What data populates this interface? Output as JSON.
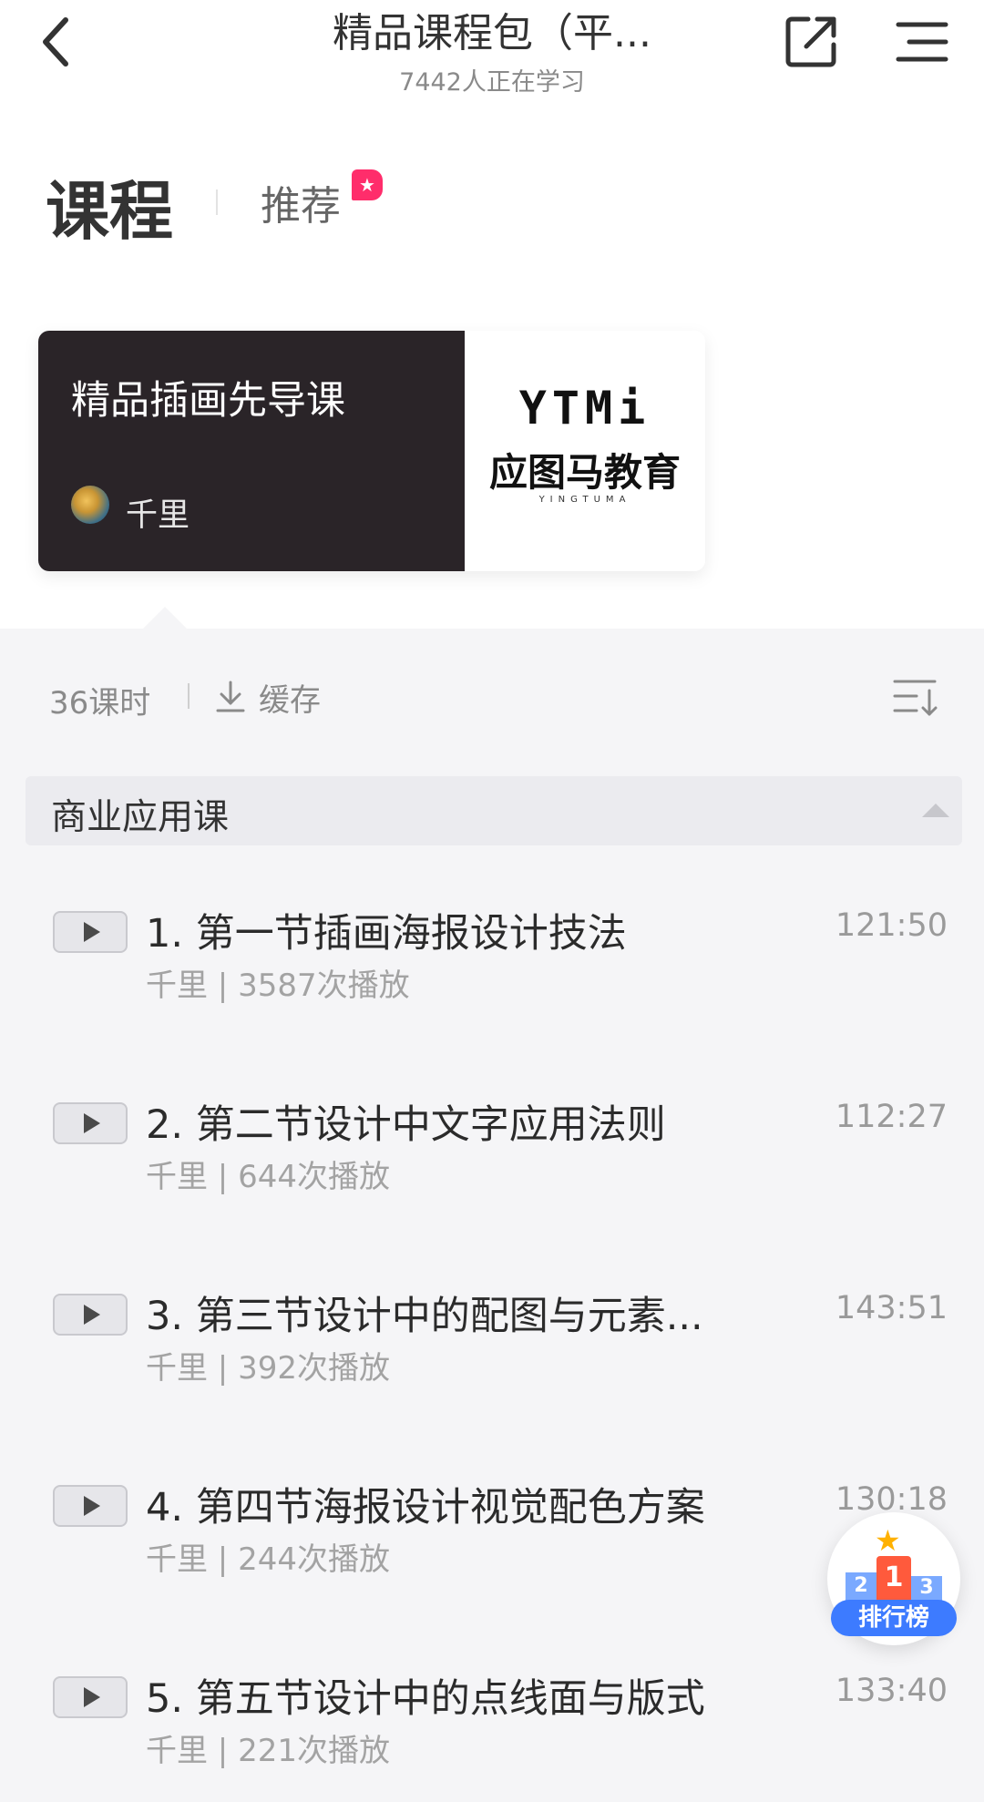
{
  "nav": {
    "title": "精品课程包（平...",
    "subtitle": "7442人正在学习"
  },
  "tabs": {
    "course": "课程",
    "recommend": "推荐"
  },
  "course_card": {
    "title": "精品插画先导课",
    "author": "千里",
    "logo_mark": "YTMi",
    "logo_cn": "应图马教育",
    "logo_en": "YINGTUMA"
  },
  "meta": {
    "lesson_count": "36课时",
    "cache_label": "缓存"
  },
  "section": {
    "title": "商业应用课"
  },
  "lessons": [
    {
      "title": "1. 第一节插画海报设计技法",
      "duration": "121:50",
      "meta": "千里 | 3587次播放"
    },
    {
      "title": "2. 第二节设计中文字应用法则",
      "duration": "112:27",
      "meta": "千里 | 644次播放"
    },
    {
      "title": "3. 第三节设计中的配图与元素...",
      "duration": "143:51",
      "meta": "千里 | 392次播放"
    },
    {
      "title": "4. 第四节海报设计视觉配色方案",
      "duration": "130:18",
      "meta": "千里 | 244次播放"
    },
    {
      "title": "5. 第五节设计中的点线面与版式",
      "duration": "133:40",
      "meta": "千里 | 221次播放"
    }
  ],
  "rank_fab": {
    "label": "排行榜",
    "p1": "1",
    "p2": "2",
    "p3": "3"
  },
  "colors": {
    "accent_pink": "#ff2d6b",
    "rank_blue": "#3d7bff",
    "card_dark": "#2a2428"
  }
}
